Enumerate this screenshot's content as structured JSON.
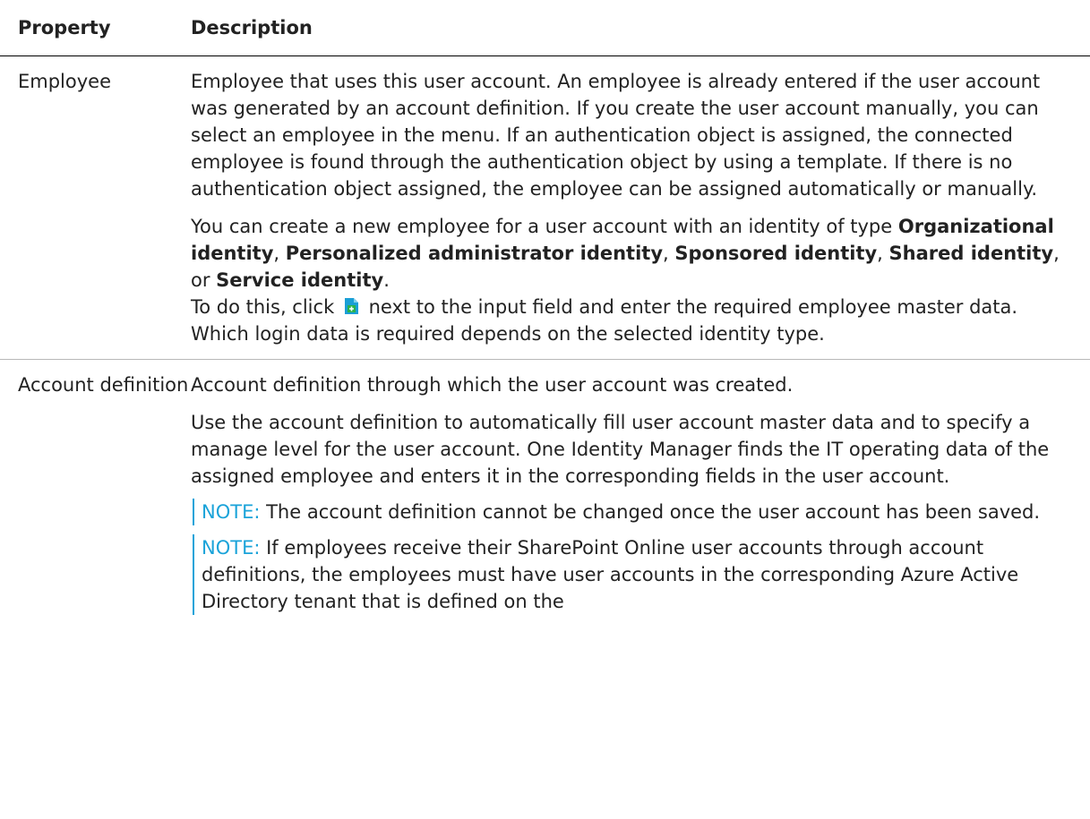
{
  "header": {
    "property": "Property",
    "description": "Description"
  },
  "rows": [
    {
      "property": "Employee",
      "p1": "Employee that uses this user account. An employee is already entered if the user account was generated by an account definition. If you create the user account manually, you can select an employee in the menu. If an authentication object is assigned, the connected employee is found through the authentication object by using a template. If there is no authentication object assigned, the employee can be assigned automatically or manually.",
      "p2_a": "You can create a new employee for a user account with an identity of type ",
      "p2_b1": "Organizational identity",
      "p2_s1": ", ",
      "p2_b2": "Personalized administrator identity",
      "p2_s2": ", ",
      "p2_b3": "Sponsored identity",
      "p2_s3": ", ",
      "p2_b4": "Shared identity",
      "p2_s4": ", or ",
      "p2_b5": "Service identity",
      "p2_s5": ".",
      "p3_a": "To do this, click ",
      "p3_icon": "add-new-icon",
      "p3_b": " next to the input field and enter the required employee master data. Which login data is required depends on the selected identity type."
    },
    {
      "property": "Account definition",
      "p1": "Account definition through which the user account was created.",
      "p2": "Use the account definition to automatically fill user account master data and to specify a manage level for the user account. One Identity Manager finds the IT operating data of the assigned employee and enters it in the corresponding fields in the user account.",
      "note1_label": "NOTE:",
      "note1_text": " The account definition cannot be changed once the user account has been saved.",
      "note2_label": "NOTE:",
      "note2_text": " If employees receive their SharePoint Online user accounts through account definitions, the employees must have user accounts in the corresponding Azure Active Directory tenant that is defined on the"
    }
  ],
  "colors": {
    "note_accent": "#1aa3d9",
    "icon_blue": "#1a9fd6"
  }
}
